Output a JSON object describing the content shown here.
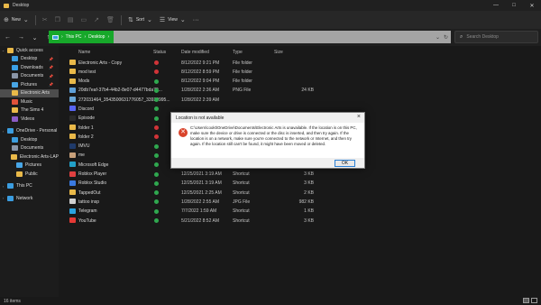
{
  "window": {
    "title": "Desktop",
    "controls": [
      "—",
      "□",
      "✕"
    ]
  },
  "toolbar": {
    "new_label": "New",
    "sort_label": "Sort",
    "view_label": "View",
    "more_label": "···",
    "disabled_icons": [
      "cut-icon",
      "copy-icon",
      "paste-icon",
      "rename-icon",
      "share-icon",
      "delete-icon"
    ]
  },
  "address": {
    "crumbs": [
      "This PC",
      "Desktop"
    ],
    "search_placeholder": "Search Desktop"
  },
  "nav": {
    "items": [
      {
        "label": "Quick access",
        "level": 0,
        "expand": "⌄",
        "icon": "star-icon",
        "color": "#e9b949"
      },
      {
        "label": "Desktop",
        "level": 1,
        "pinned": true,
        "icon": "desktop-icon",
        "color": "#3b9de0"
      },
      {
        "label": "Downloads",
        "level": 1,
        "pinned": true,
        "icon": "download-icon",
        "color": "#3aa0e8"
      },
      {
        "label": "Documents",
        "level": 1,
        "pinned": true,
        "icon": "document-icon",
        "color": "#8a96a8"
      },
      {
        "label": "Pictures",
        "level": 1,
        "pinned": true,
        "icon": "pictures-icon",
        "color": "#48a6e6"
      },
      {
        "label": "Electronic Arts",
        "level": 1,
        "selected": true,
        "icon": "folder-icon",
        "color": "#e9b949"
      },
      {
        "label": "Music",
        "level": 1,
        "icon": "music-icon",
        "color": "#e0523a"
      },
      {
        "label": "The Sims 4",
        "level": 1,
        "icon": "folder-icon",
        "color": "#e9b949"
      },
      {
        "label": "Videos",
        "level": 1,
        "icon": "video-icon",
        "color": "#8b5cc7"
      },
      {
        "gap": true
      },
      {
        "label": "OneDrive - Personal",
        "level": 0,
        "expand": "›",
        "icon": "cloud-icon",
        "color": "#3b9de0"
      },
      {
        "label": "Desktop",
        "level": 1,
        "icon": "desktop-icon",
        "color": "#3b9de0"
      },
      {
        "label": "Documents",
        "level": 1,
        "icon": "document-icon",
        "color": "#8a96a8"
      },
      {
        "label": "Electronic Arts-LAP",
        "level": 1,
        "icon": "folder-icon",
        "color": "#e9b949"
      },
      {
        "label": "Pictures",
        "level": 2,
        "icon": "pictures-icon",
        "color": "#48a6e6"
      },
      {
        "label": "Public",
        "level": 2,
        "icon": "folder-icon",
        "color": "#e9b949"
      },
      {
        "gap": true
      },
      {
        "label": "This PC",
        "level": 0,
        "expand": "›",
        "icon": "computer-icon",
        "color": "#3b9de0"
      },
      {
        "gap": true
      },
      {
        "label": "Network",
        "level": 0,
        "expand": "›",
        "icon": "network-icon",
        "color": "#3b9de0"
      }
    ]
  },
  "columns": {
    "name": "Name",
    "status": "Status",
    "date": "Date modified",
    "type": "Type",
    "size": "Size"
  },
  "files": [
    {
      "name": "Electronic Arts - Copy",
      "status": "error",
      "date": "8/12/2022 9:21 PM",
      "type": "File folder",
      "size": "",
      "icon": "folder-icon",
      "color": "#e9b949"
    },
    {
      "name": "mod test",
      "status": "error",
      "date": "8/12/2022 8:59 PM",
      "type": "File folder",
      "size": "",
      "icon": "folder-icon",
      "color": "#e9b949"
    },
    {
      "name": "Mods",
      "status": "ok",
      "date": "8/12/2022 9:04 PM",
      "type": "File folder",
      "size": "",
      "icon": "folder-icon",
      "color": "#e9b949"
    },
    {
      "name": "20db7eaf-37b4-44b2-8e07-d4477bda70...",
      "status": "ok",
      "date": "1/28/2022 2:36 AM",
      "type": "PNG File",
      "size": "24 KB",
      "icon": "image-icon",
      "color": "#5fa0d8"
    },
    {
      "name": "272031464_3543500631776057_33939995...",
      "status": "ok",
      "date": "1/28/2022 2:39 AM",
      "type": "",
      "size": "",
      "icon": "image-icon",
      "color": "#6aa7d8"
    },
    {
      "name": "Discord",
      "status": "ok",
      "date": "",
      "type": "",
      "size": "",
      "icon": "discord-icon",
      "color": "#5865f2"
    },
    {
      "name": "Episode",
      "status": "ok",
      "date": "",
      "type": "",
      "size": "",
      "icon": "app-icon",
      "color": "#2b2b2b"
    },
    {
      "name": "folder 1",
      "status": "error",
      "date": "",
      "type": "",
      "size": "",
      "icon": "folder-icon",
      "color": "#e9b949"
    },
    {
      "name": "folder 2",
      "status": "error",
      "date": "",
      "type": "",
      "size": "",
      "icon": "folder-icon",
      "color": "#e9b949"
    },
    {
      "name": "IMVU",
      "status": "ok",
      "date": "",
      "type": "",
      "size": "",
      "icon": "app-icon",
      "color": "#1f3a6a"
    },
    {
      "name": "me",
      "status": "ok",
      "date": "6/16/2022 12:37 AM",
      "type": "JPG File",
      "size": "483 KB",
      "icon": "image-icon",
      "color": "#c8a07a"
    },
    {
      "name": "Microsoft Edge",
      "status": "ok",
      "date": "12/24/2021 10:54 PM",
      "type": "Shortcut",
      "size": "3 KB",
      "icon": "edge-icon",
      "color": "#22a0c8"
    },
    {
      "name": "Roblox Player",
      "status": "ok",
      "date": "12/25/2021 3:19 AM",
      "type": "Shortcut",
      "size": "3 KB",
      "icon": "roblox-icon",
      "color": "#e04040"
    },
    {
      "name": "Roblox Studio",
      "status": "ok",
      "date": "12/25/2021 3:19 AM",
      "type": "Shortcut",
      "size": "3 KB",
      "icon": "roblox-studio-icon",
      "color": "#3a7ae0"
    },
    {
      "name": "TappedOut",
      "status": "ok",
      "date": "12/25/2021 2:25 AM",
      "type": "Shortcut",
      "size": "2 KB",
      "icon": "app-icon",
      "color": "#e9b949"
    },
    {
      "name": "tattoo insp",
      "status": "ok",
      "date": "1/28/2022 2:55 AM",
      "type": "JPG File",
      "size": "982 KB",
      "icon": "image-icon",
      "color": "#d0d0d0"
    },
    {
      "name": "Telegram",
      "status": "ok",
      "date": "7/7/2022 1:59 AM",
      "type": "Shortcut",
      "size": "1 KB",
      "icon": "telegram-icon",
      "color": "#2aa3e0"
    },
    {
      "name": "YouTube",
      "status": "ok",
      "date": "5/21/2022 8:52 AM",
      "type": "Shortcut",
      "size": "3 KB",
      "icon": "youtube-icon",
      "color": "#e53935"
    }
  ],
  "status_colors": {
    "ok": "#2fa84f",
    "error": "#d13438"
  },
  "statusbar": {
    "count": "16 items"
  },
  "dialog": {
    "title": "Location is not available",
    "message": "C:\\Users\\cookt\\OneDrive\\Documents\\Electronic Arts is unavailable. If the location is on this PC, make sure the device or drive is connected or the disc is inserted, and then try again. If the location is on a network, make sure you're connected to the network or Internet, and then try again. If the location still can't be found, it might have been moved or deleted.",
    "ok_label": "OK",
    "icon": "error-icon"
  }
}
